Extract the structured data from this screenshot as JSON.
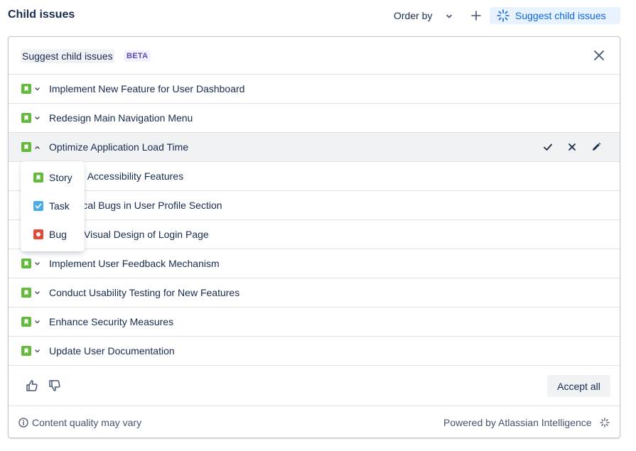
{
  "header": {
    "title": "Child issues",
    "order_by_label": "Order by",
    "suggest_button_label": "Suggest child issues"
  },
  "panel": {
    "title": "Suggest child issues",
    "badge": "BETA",
    "items": [
      {
        "label": "Implement New Feature for User Dashboard",
        "type": "story"
      },
      {
        "label": "Redesign Main Navigation Menu",
        "type": "story"
      },
      {
        "label": "Optimize Application Load Time",
        "type": "story"
      },
      {
        "label": "Improve Accessibility Features",
        "type": "story"
      },
      {
        "label": "Fix Critical Bugs in User Profile Section",
        "type": "story"
      },
      {
        "label": "Update Visual Design of Login Page",
        "type": "story"
      },
      {
        "label": "Implement User Feedback Mechanism",
        "type": "story"
      },
      {
        "label": "Conduct Usability Testing for New Features",
        "type": "story"
      },
      {
        "label": "Enhance Security Measures",
        "type": "story"
      },
      {
        "label": "Update User Documentation",
        "type": "story"
      }
    ],
    "type_menu": [
      {
        "label": "Story",
        "icon": "story-icon"
      },
      {
        "label": "Task",
        "icon": "task-icon"
      },
      {
        "label": "Bug",
        "icon": "bug-icon"
      }
    ],
    "accept_all_label": "Accept all",
    "info_text": "Content quality may vary",
    "powered_by": "Powered by Atlassian Intelligence"
  },
  "colors": {
    "story": "#63ba3c",
    "task": "#4bade8",
    "bug": "#e5493a",
    "accent": "#0c66e4",
    "accent_bg": "#e9f2ff",
    "beta": "#5e4db2"
  }
}
